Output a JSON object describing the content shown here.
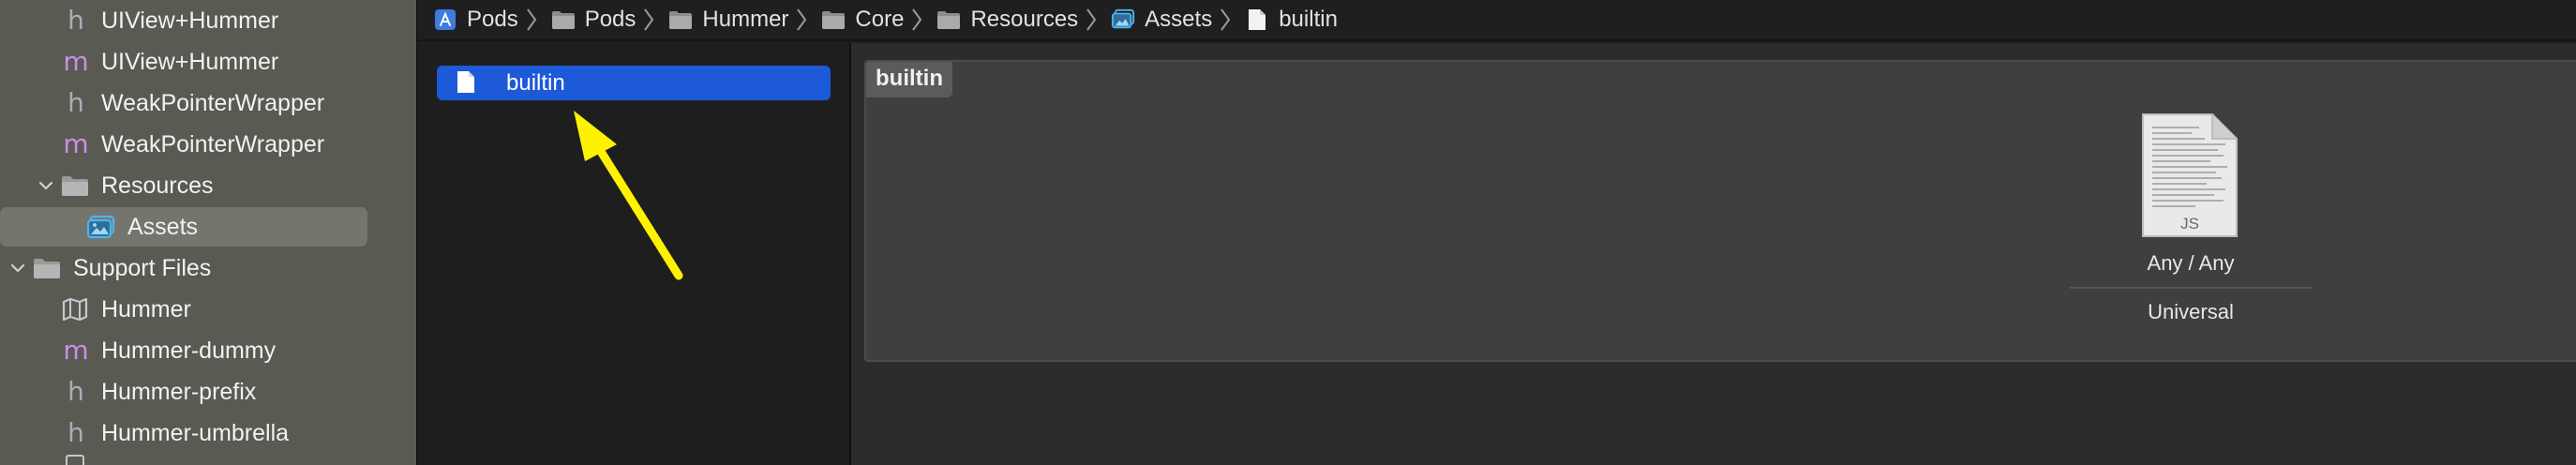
{
  "navigator": {
    "items": [
      {
        "type_letter": "h",
        "label": "UIView+Hummer"
      },
      {
        "type_letter": "m",
        "label": "UIView+Hummer"
      },
      {
        "type_letter": "h",
        "label": "WeakPointerWrapper"
      },
      {
        "type_letter": "m",
        "label": "WeakPointerWrapper"
      },
      {
        "label": "Resources",
        "icon": "folder-icon"
      },
      {
        "label": "Assets",
        "icon": "asset-catalog-icon"
      },
      {
        "label": "Support Files",
        "icon": "folder-icon"
      },
      {
        "label": "Hummer",
        "icon": "module-map-icon"
      },
      {
        "type_letter": "m",
        "label": "Hummer-dummy"
      },
      {
        "type_letter": "h",
        "label": "Hummer-prefix"
      },
      {
        "type_letter": "h",
        "label": "Hummer-umbrella"
      }
    ]
  },
  "jumpbar": {
    "crumbs": [
      {
        "label": "Pods",
        "icon": "xcode-project-icon"
      },
      {
        "label": "Pods",
        "icon": "folder-icon"
      },
      {
        "label": "Hummer",
        "icon": "folder-icon"
      },
      {
        "label": "Core",
        "icon": "folder-icon"
      },
      {
        "label": "Resources",
        "icon": "folder-icon"
      },
      {
        "label": "Assets",
        "icon": "asset-catalog-icon"
      },
      {
        "label": "builtin",
        "icon": "document-icon"
      }
    ]
  },
  "asset_list": {
    "selected": {
      "label": "builtin",
      "icon": "document-icon"
    }
  },
  "detail": {
    "set_title": "builtin",
    "slot": {
      "doc_badge": "JS",
      "appearance": "Any / Any",
      "device": "Universal"
    }
  },
  "colors": {
    "selection_blue": "#1d5ad8",
    "annotation_arrow": "#fff200",
    "swift_header_letter": "#a8adb6",
    "objc_impl_letter": "#c88ee8"
  }
}
